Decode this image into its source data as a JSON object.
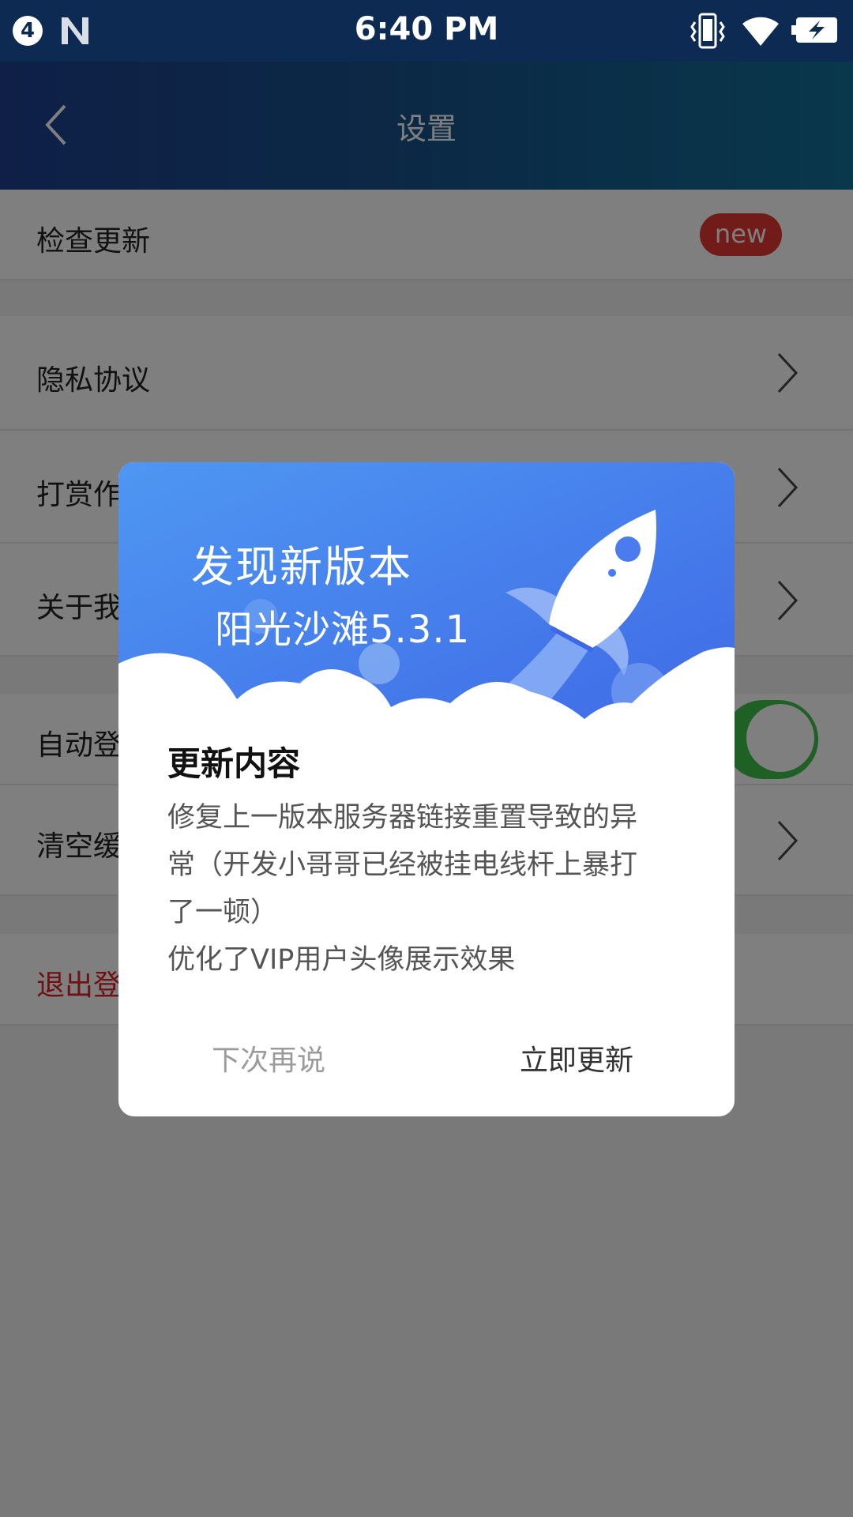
{
  "status_bar": {
    "notification_count": "4",
    "time": "6:40 PM",
    "icons": [
      "android-n-icon",
      "vibrate-icon",
      "wifi-icon",
      "battery-charging-icon"
    ]
  },
  "app_bar": {
    "title": "设置",
    "back_icon": "chevron-left-icon"
  },
  "settings": {
    "check_update": {
      "label": "检查更新",
      "badge": "new"
    },
    "privacy": {
      "label": "隐私协议"
    },
    "reward": {
      "label": "打赏作"
    },
    "about": {
      "label": "关于我"
    },
    "auto_login": {
      "label": "自动登",
      "enabled": true
    },
    "clear_cache": {
      "label": "清空缓"
    },
    "logout": {
      "label": "退出登"
    }
  },
  "dialog": {
    "hero_title": "发现新版本",
    "hero_version": "阳光沙滩5.3.1",
    "content_title": "更新内容",
    "content_lines": [
      "修复上一版本服务器链接重置导致的异",
      "常（开发小哥哥已经被挂电线杆上暴打",
      "了一顿）",
      "优化了VIP用户头像展示效果"
    ],
    "later_label": "下次再说",
    "update_label": "立即更新"
  },
  "colors": {
    "status_bar": "#0d2a52",
    "app_bar_start": "#1e3f8f",
    "app_bar_end": "#126f98",
    "badge_red": "#e53935",
    "logout_red": "#e02020",
    "toggle_green": "#3fc04a",
    "hero_blue": "#4a86f0"
  }
}
